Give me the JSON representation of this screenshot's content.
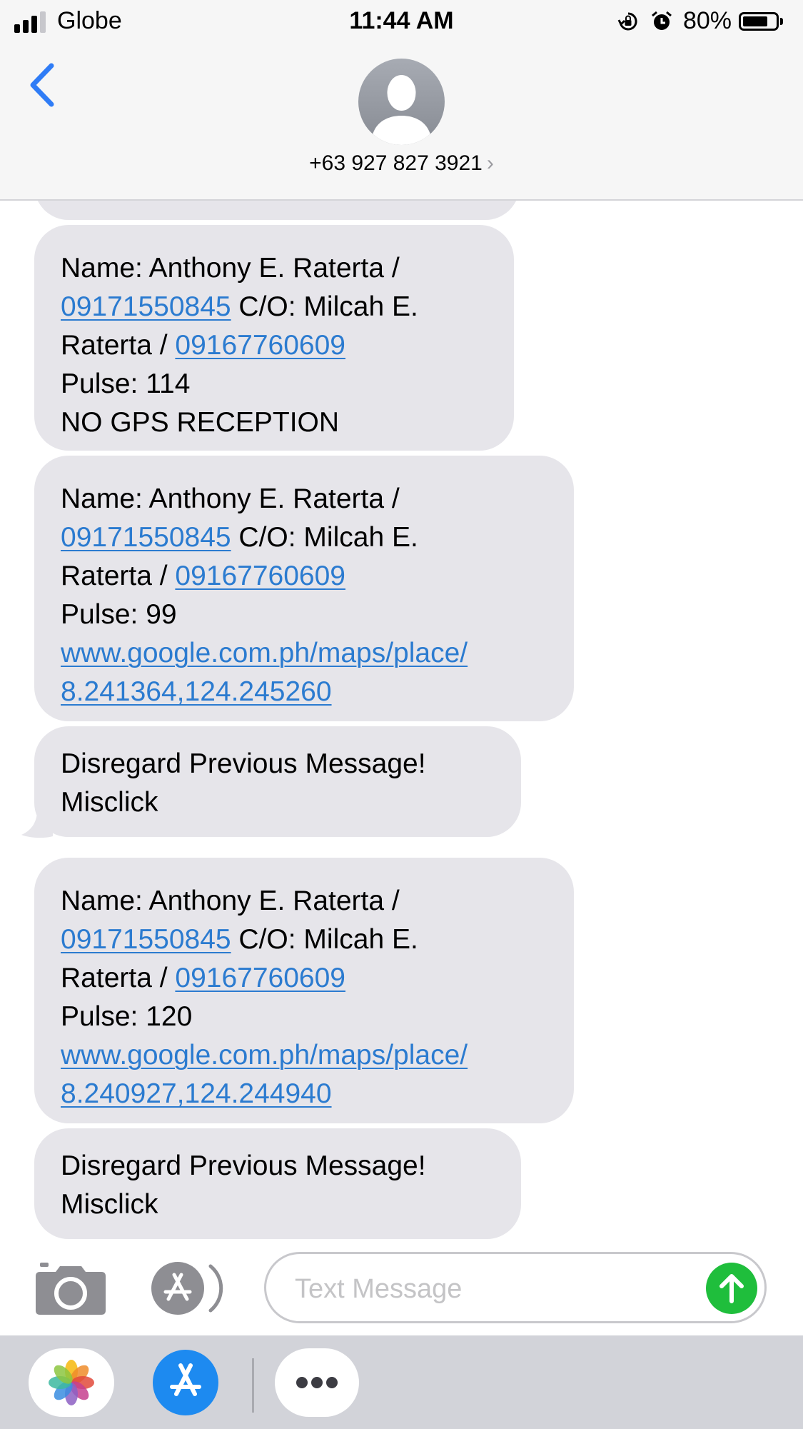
{
  "status_bar": {
    "carrier": "Globe",
    "time": "11:44 AM",
    "battery_percent": "80%",
    "battery_level": 0.8,
    "signal_bars": 3
  },
  "header": {
    "contact": "+63 927 827 3921",
    "chevron": "›"
  },
  "messages": [
    {
      "lines": [
        [
          "Name: Anthony E. Raterta /"
        ],
        [
          {
            "link": "09171550845"
          },
          " C/O: Milcah E."
        ],
        [
          "Raterta / ",
          {
            "link": "09167760609"
          }
        ],
        [
          "Pulse: 114"
        ],
        [
          "NO GPS RECEPTION"
        ]
      ]
    },
    {
      "lines": [
        [
          "Name: Anthony E. Raterta /"
        ],
        [
          {
            "link": "09171550845"
          },
          " C/O: Milcah E."
        ],
        [
          "Raterta / ",
          {
            "link": "09167760609"
          }
        ],
        [
          "Pulse: 99"
        ],
        [
          {
            "link": "www.google.com.ph/maps/place/"
          }
        ],
        [
          {
            "link": "8.241364,124.245260"
          }
        ]
      ]
    },
    {
      "lines": [
        [
          "Disregard Previous Message!"
        ],
        [
          "Misclick"
        ]
      ]
    },
    {
      "lines": [
        [
          "Name: Anthony E. Raterta /"
        ],
        [
          {
            "link": "09171550845"
          },
          " C/O: Milcah E."
        ],
        [
          "Raterta / ",
          {
            "link": "09167760609"
          }
        ],
        [
          "Pulse: 120"
        ],
        [
          {
            "link": "www.google.com.ph/maps/place/"
          }
        ],
        [
          {
            "link": "8.240927,124.244940"
          }
        ]
      ]
    },
    {
      "lines": [
        [
          "Disregard Previous Message!"
        ],
        [
          "Misclick"
        ]
      ]
    }
  ],
  "input": {
    "placeholder": "Text Message",
    "value": ""
  },
  "colors": {
    "bubble": "#e6e5ea",
    "link": "#2b7bd0",
    "send": "#1fbe3c",
    "back_arrow": "#2f7cf6"
  },
  "icons": {
    "back": "chevron-left-icon",
    "camera": "camera-icon",
    "appstore": "app-store-icon",
    "send": "arrow-up-icon",
    "photos": "photos-app-icon",
    "more": "more-icon"
  }
}
